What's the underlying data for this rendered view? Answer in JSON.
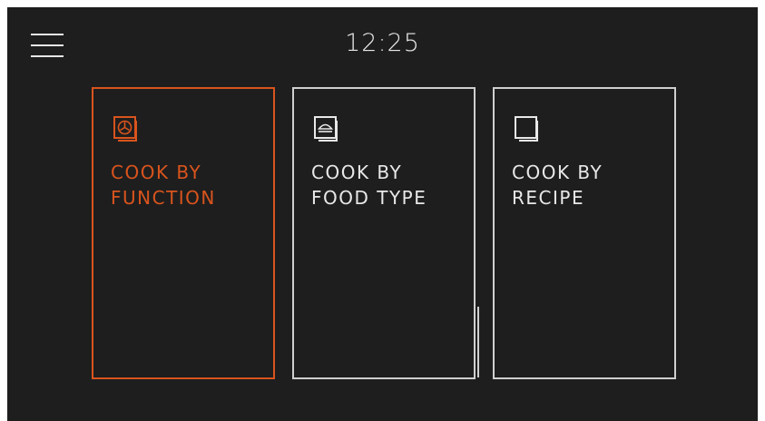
{
  "header": {
    "time": "12:25",
    "menu_icon": "hamburger-menu-icon"
  },
  "cards": [
    {
      "line1": "COOK BY",
      "line2": "FUNCTION",
      "icon": "oven-function-icon",
      "selected": true
    },
    {
      "line1": "COOK BY",
      "line2": "FOOD TYPE",
      "icon": "food-type-icon",
      "selected": false
    },
    {
      "line1": "COOK BY",
      "line2": "RECIPE",
      "icon": "recipe-book-icon",
      "selected": false
    }
  ],
  "colors": {
    "background": "#1e1e1e",
    "accent": "#d9541d",
    "text": "#e8e8e8",
    "border": "#cfcfcf"
  }
}
